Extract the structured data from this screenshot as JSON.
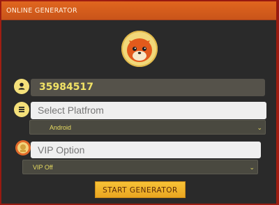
{
  "header": {
    "title": "ONLINE GENERATOR"
  },
  "username": {
    "value": "35984517",
    "icon": "user-icon"
  },
  "platform": {
    "placeholder": "Select Platfrom",
    "icon": "list-icon",
    "selected": "Android"
  },
  "vip": {
    "placeholder": "VIP Option",
    "icon": "vip-avatar-icon",
    "selected": "VIP Off"
  },
  "start_button": {
    "label": "START GENERATOR"
  },
  "colors": {
    "background": "#981a10",
    "panel": "#2a2a2a",
    "header": "#d95d1c",
    "accent": "#f2e366",
    "button": "#f2b82e"
  }
}
